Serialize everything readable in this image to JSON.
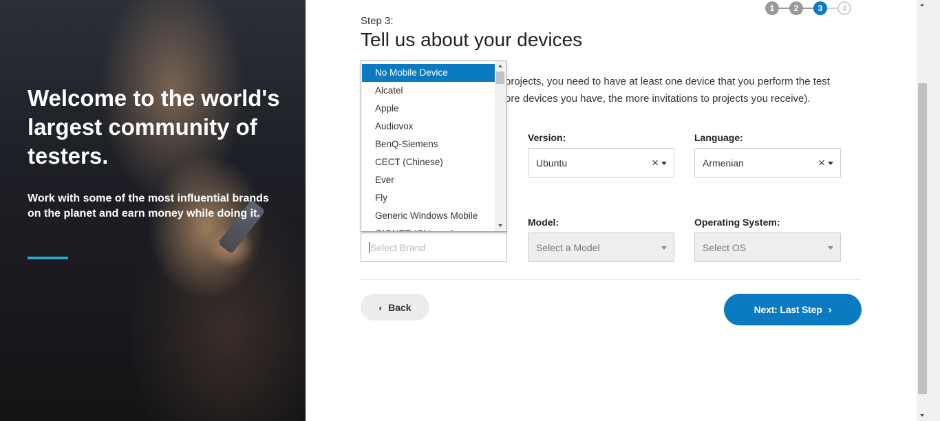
{
  "hero": {
    "title": "Welcome to the world's largest community of testers.",
    "subtitle": "Work with some of the most influential brands on the planet and earn money while doing it.",
    "accent_color": "#2ba6cb"
  },
  "stepper": {
    "steps": [
      "1",
      "2",
      "3",
      "4"
    ],
    "current": 3
  },
  "form": {
    "step_label": "Step 3:",
    "title": "Tell us about your devices",
    "intro_line1_visible": "projects, you need to have at least one device that you perform the test",
    "intro_line2_visible": "ore devices you have, the more invitations to projects you receive).",
    "version": {
      "label": "Version:",
      "value": "Ubuntu"
    },
    "language": {
      "label": "Language:",
      "value": "Armenian"
    },
    "model": {
      "label": "Model:",
      "placeholder": "Select a Model"
    },
    "os": {
      "label": "Operating System:",
      "placeholder": "Select OS"
    },
    "brand": {
      "placeholder": "Select Brand"
    }
  },
  "dropdown": {
    "items": [
      "No Mobile Device",
      "Alcatel",
      "Apple",
      "Audiovox",
      "BenQ-Siemens",
      "CECT (Chinese)",
      "Ever",
      "Fly",
      "Generic Windows Mobile",
      "GIONEE (Chinese)"
    ],
    "selected_index": 0
  },
  "buttons": {
    "back": "Back",
    "next": "Next: Last Step"
  },
  "colors": {
    "primary": "#0b7bc1",
    "step_done": "#9a9a9a"
  }
}
